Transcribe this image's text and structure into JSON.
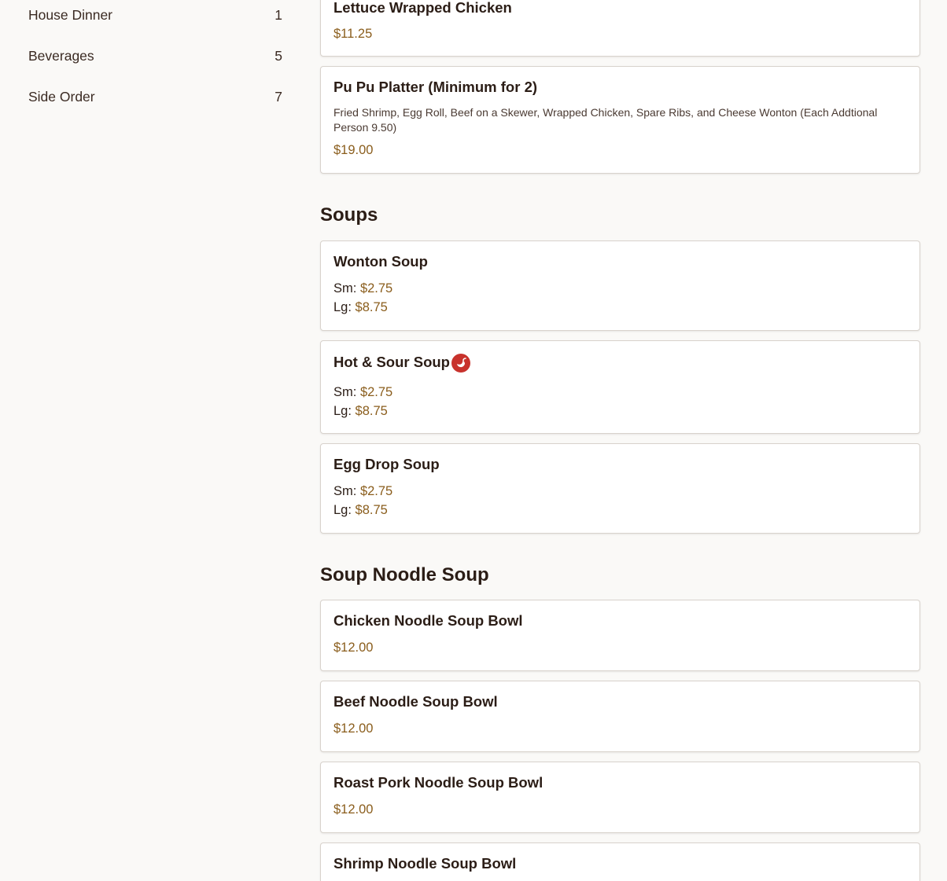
{
  "sidebar": {
    "categories": [
      {
        "name": "House Dinner",
        "count": "1"
      },
      {
        "name": "Beverages",
        "count": "5"
      },
      {
        "name": "Side Order",
        "count": "7"
      }
    ]
  },
  "menu": {
    "appetizers_tail": [
      {
        "name": "Lettuce Wrapped Chicken",
        "price": "$11.25"
      },
      {
        "name": "Pu Pu Platter (Minimum for 2)",
        "description": "Fried Shrimp, Egg Roll, Beef on a Skewer, Wrapped Chicken, Spare Ribs, and Cheese Wonton (Each Addtional Person 9.50)",
        "price": "$19.00"
      }
    ],
    "soups": {
      "title": "Soups",
      "items": [
        {
          "name": "Wonton Soup",
          "sm_label": "Sm:",
          "sm_price": "$2.75",
          "lg_label": "Lg:",
          "lg_price": "$8.75"
        },
        {
          "name": "Hot & Sour Soup",
          "icon": "spicy-pepper-icon",
          "icon_color": "#c8322c",
          "sm_label": "Sm:",
          "sm_price": "$2.75",
          "lg_label": "Lg:",
          "lg_price": "$8.75"
        },
        {
          "name": "Egg Drop Soup",
          "sm_label": "Sm:",
          "sm_price": "$2.75",
          "lg_label": "Lg:",
          "lg_price": "$8.75"
        }
      ]
    },
    "soup_noodle": {
      "title": "Soup Noodle Soup",
      "items": [
        {
          "name": "Chicken Noodle Soup Bowl",
          "price": "$12.00"
        },
        {
          "name": "Beef Noodle Soup Bowl",
          "price": "$12.00"
        },
        {
          "name": "Roast Pork Noodle Soup Bowl",
          "price": "$12.00"
        },
        {
          "name": "Shrimp Noodle Soup Bowl"
        }
      ]
    }
  },
  "colors": {
    "background": "#faf9f7",
    "price": "#8a5d1c",
    "text": "#2b1d16",
    "card_border": "#d8d2cc"
  }
}
